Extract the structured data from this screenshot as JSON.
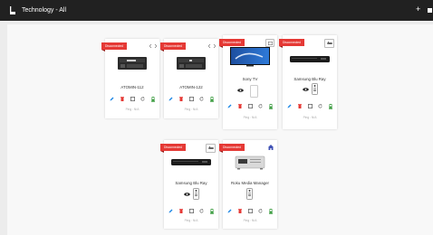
{
  "header": {
    "title": "Technology - All"
  },
  "colors": {
    "topbar": "#212121",
    "badge": "#e53935",
    "accent_green": "#43a047",
    "accent_blue": "#1e88e5",
    "accent_red": "#e53935"
  },
  "icons": [
    "back-icon",
    "plus-icon",
    "expand-icon",
    "info-icon",
    "edit-icon",
    "delete-icon",
    "stop-icon",
    "refresh-icon",
    "battery-icon",
    "eye-icon",
    "remote-icon",
    "roku-icon"
  ],
  "cards": [
    {
      "badge": "Disconnected",
      "name": "ATOMIN-112",
      "ping": "Ping : N/A"
    },
    {
      "badge": "Disconnected",
      "name": "ATOMIN-122",
      "ping": "Ping : N/A"
    },
    {
      "badge": "Disconnected",
      "name": "Sony TV",
      "ping": "Ping : N/A",
      "corner": "Info"
    },
    {
      "badge": "Disconnected",
      "name": "Samsung Blu Ray",
      "ping": "Ping : N/A",
      "corner": "Info"
    },
    {
      "badge": "Disconnected",
      "name": "Samsung Blu Ray",
      "ping": "Ping : N/A",
      "corner": "Info"
    },
    {
      "badge": "Disconnected",
      "name": "Roku Media Manager",
      "ping": "Ping : N/A"
    }
  ]
}
